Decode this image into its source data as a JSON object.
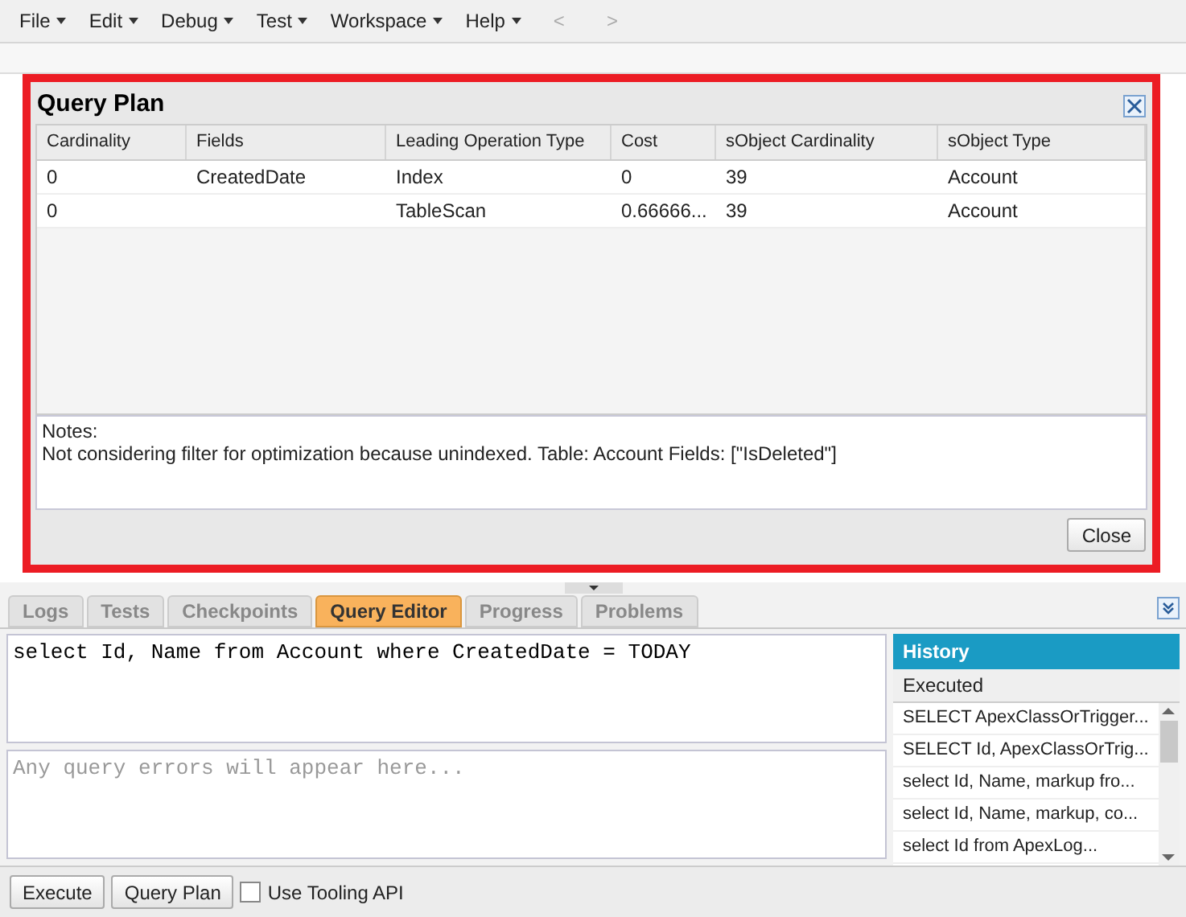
{
  "menu": [
    {
      "label": "File"
    },
    {
      "label": "Edit"
    },
    {
      "label": "Debug"
    },
    {
      "label": "Test"
    },
    {
      "label": "Workspace"
    },
    {
      "label": "Help"
    }
  ],
  "nav": [
    {
      "label": "<",
      "disabled": true
    },
    {
      "label": ">",
      "disabled": true
    }
  ],
  "dialog": {
    "title": "Query Plan",
    "table": {
      "columns": [
        "Cardinality",
        "Fields",
        "Leading Operation Type",
        "Cost",
        "sObject Cardinality",
        "sObject Type"
      ],
      "rows": [
        [
          "0",
          "CreatedDate",
          "Index",
          "0",
          "39",
          "Account"
        ],
        [
          "0",
          "",
          "TableScan",
          "0.66666...",
          "39",
          "Account"
        ]
      ]
    },
    "notes": {
      "label": "Notes:",
      "text": "Not considering filter for optimization because unindexed. Table: Account Fields: [\"IsDeleted\"]"
    },
    "close_button": "Close"
  },
  "tabs": [
    {
      "label": "Logs",
      "selected": false
    },
    {
      "label": "Tests",
      "selected": false
    },
    {
      "label": "Checkpoints",
      "selected": false
    },
    {
      "label": "Query Editor",
      "selected": true
    },
    {
      "label": "Progress",
      "selected": false
    },
    {
      "label": "Problems",
      "selected": false
    }
  ],
  "editor": {
    "value": "select Id, Name from Account where CreatedDate = TODAY"
  },
  "errors": {
    "placeholder": "Any query errors will appear here..."
  },
  "history": {
    "title": "History",
    "column": "Executed",
    "items": [
      "SELECT ApexClassOrTrigger...",
      "SELECT Id, ApexClassOrTrig...",
      "select Id, Name, markup fro...",
      "select Id, Name, markup, co...",
      "select Id from ApexLog..."
    ]
  },
  "buttons": [
    "Execute",
    "Query Plan"
  ],
  "tooling": {
    "label": "Use Tooling API",
    "checked": false
  }
}
